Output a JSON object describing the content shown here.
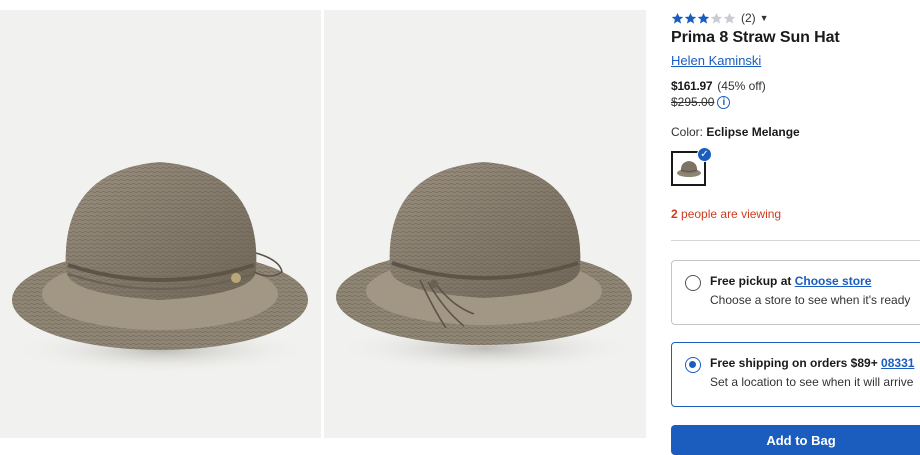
{
  "product": {
    "rating_value": 3,
    "rating_max": 5,
    "review_count": "(2)",
    "title": "Prima 8 Straw Sun Hat",
    "brand": "Helen Kaminski",
    "price": "$161.97",
    "discount": "(45% off)",
    "original_price": "$295.00",
    "color_label": "Color:",
    "color_value": "Eclipse Melange",
    "viewing_count": "2",
    "viewing_text": " people are viewing"
  },
  "fulfillment": {
    "pickup": {
      "title": "Free pickup at ",
      "link": "Choose store",
      "subtitle": "Choose a store to see when it's ready"
    },
    "shipping": {
      "title": "Free shipping on orders $89+ ",
      "link": "08331",
      "subtitle": "Set a location to see when it will arrive"
    }
  },
  "cta": {
    "add_label": "Add to Bag"
  },
  "colors": {
    "accent": "#1a5dbf",
    "alert": "#d03b1e",
    "image_bg": "#f1f1ef",
    "star_filled": "#1a5dbf",
    "star_empty": "#c9ccd1"
  }
}
